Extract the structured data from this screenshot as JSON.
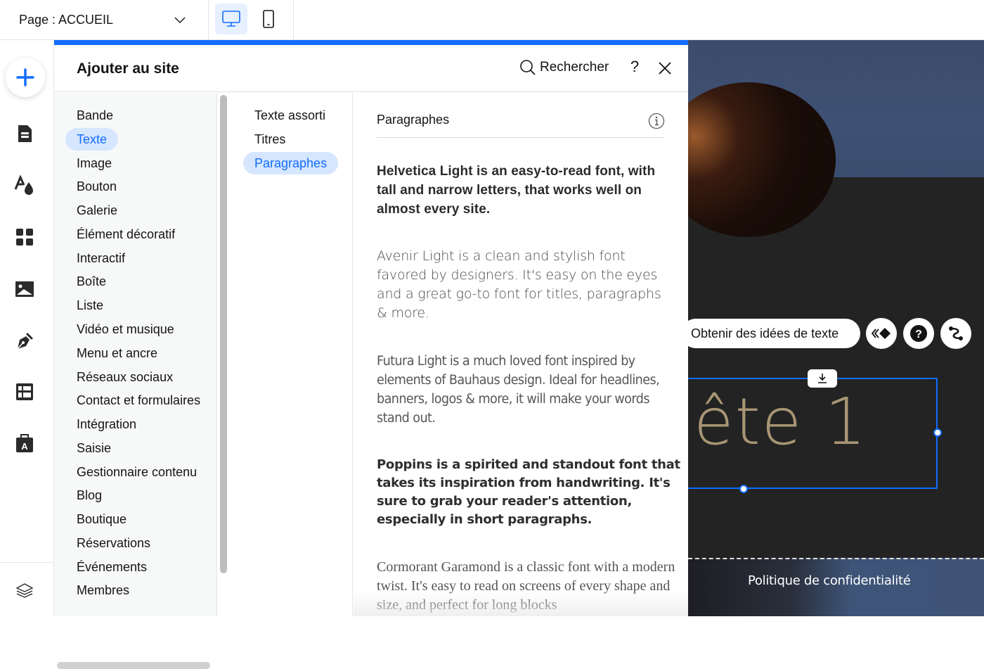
{
  "topbar": {
    "page_label": "Page : ACCUEIL",
    "device_desktop": "desktop-icon",
    "device_mobile": "mobile-icon",
    "active_device": "desktop"
  },
  "rail": {
    "items": [
      "add-elements",
      "pages-menus",
      "site-design",
      "app-market",
      "media",
      "blog",
      "cms-tables",
      "business-tools",
      "layers"
    ]
  },
  "panel": {
    "title": "Ajouter au site",
    "search_label": "Rechercher",
    "help_label": "?",
    "categories": [
      "Bande",
      "Texte",
      "Image",
      "Bouton",
      "Galerie",
      "Élément décoratif",
      "Interactif",
      "Boîte",
      "Liste",
      "Vidéo et musique",
      "Menu et ancre",
      "Réseaux sociaux",
      "Contact et formulaires",
      "Intégration",
      "Saisie",
      "Gestionnaire contenu",
      "Blog",
      "Boutique",
      "Réservations",
      "Événements",
      "Membres"
    ],
    "active_category": "Texte",
    "subcategories": [
      "Texte assorti",
      "Titres",
      "Paragraphes"
    ],
    "active_subcategory": "Paragraphes",
    "section_title": "Paragraphes",
    "paragraphs": [
      "Helvetica Light is an easy-to-read font, with tall and narrow letters, that works well on almost every site.",
      "Avenir Light is a clean and stylish font favored by designers. It's easy on the eyes and a great go-to font for titles, paragraphs & more.",
      "Futura Light is a much loved font inspired by elements of Bauhaus design. Ideal for headlines, banners, logos & more, it will make your words stand out.",
      "Poppins is a spirited and standout font that takes its inspiration from handwriting. It's sure to grab your reader's attention, especially in short paragraphs.",
      "Cormorant Garamond is a classic font with a modern twist. It's easy to read on screens of every shape and size, and perfect for long blocks"
    ]
  },
  "canvas": {
    "ideas_button": "Obtenir des idées de texte",
    "selected_text": "ête 1",
    "footer_link": "Politique de confidentialité"
  },
  "colors": {
    "accent": "#116dff",
    "active_bg": "#d6e6fe",
    "heading_text": "#a89574"
  }
}
